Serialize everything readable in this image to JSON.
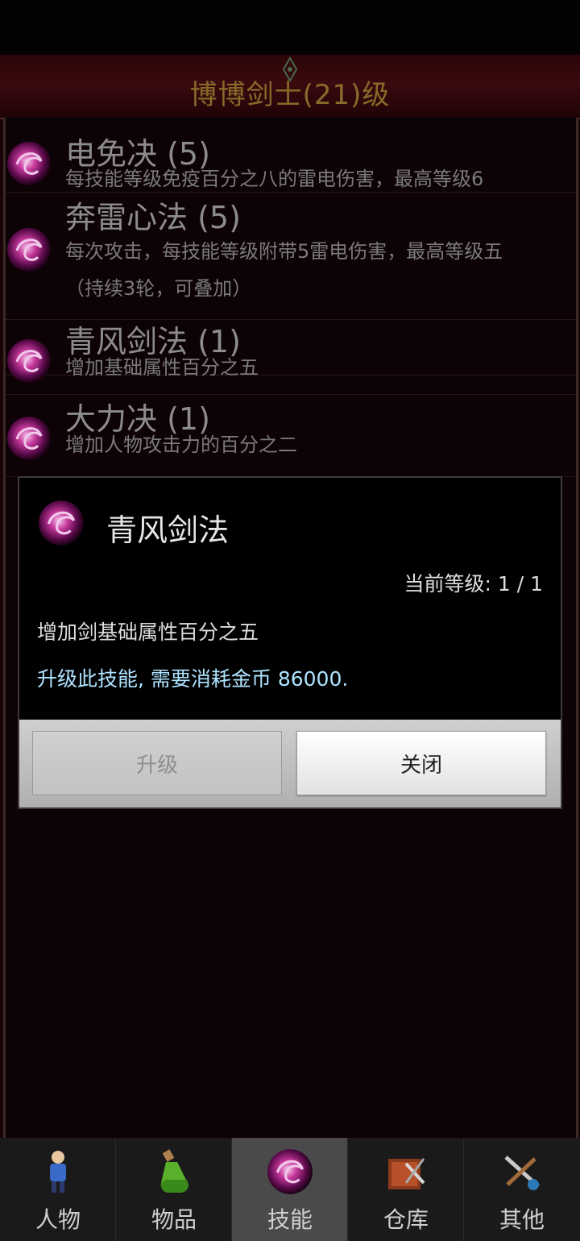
{
  "header": {
    "title": "博博剑士(21)级"
  },
  "skills": [
    {
      "name": "电免决 (5)",
      "desc": "每技能等级免疫百分之八的雷电伤害，最高等级6",
      "desc2": ""
    },
    {
      "name": "奔雷心法 (5)",
      "desc": "每次攻击，每技能等级附带5雷电伤害，最高等级五",
      "desc2": "（持续3轮，可叠加）"
    },
    {
      "name": "青风剑法 (1)",
      "desc": "增加基础属性百分之五",
      "desc2": ""
    },
    {
      "name": "大力决 (1)",
      "desc": "增加人物攻击力的百分之二",
      "desc2": ""
    }
  ],
  "dialog": {
    "title": "青风剑法",
    "level": "当前等级: 1 / 1",
    "description": "增加剑基础属性百分之五",
    "cost": "升级此技能, 需要消耗金币 86000.",
    "upgrade_label": "升级",
    "close_label": "关闭"
  },
  "nav": {
    "items": [
      {
        "label": "人物",
        "icon": "character-icon"
      },
      {
        "label": "物品",
        "icon": "potion-icon"
      },
      {
        "label": "技能",
        "icon": "skill-orb-icon"
      },
      {
        "label": "仓库",
        "icon": "warehouse-icon"
      },
      {
        "label": "其他",
        "icon": "settings-weapon-icon"
      }
    ],
    "active": "技能"
  },
  "colors": {
    "title_gold": "#8a6a2a",
    "cost_blue": "#aee3ff",
    "orb_purple": "#b02a8a"
  }
}
